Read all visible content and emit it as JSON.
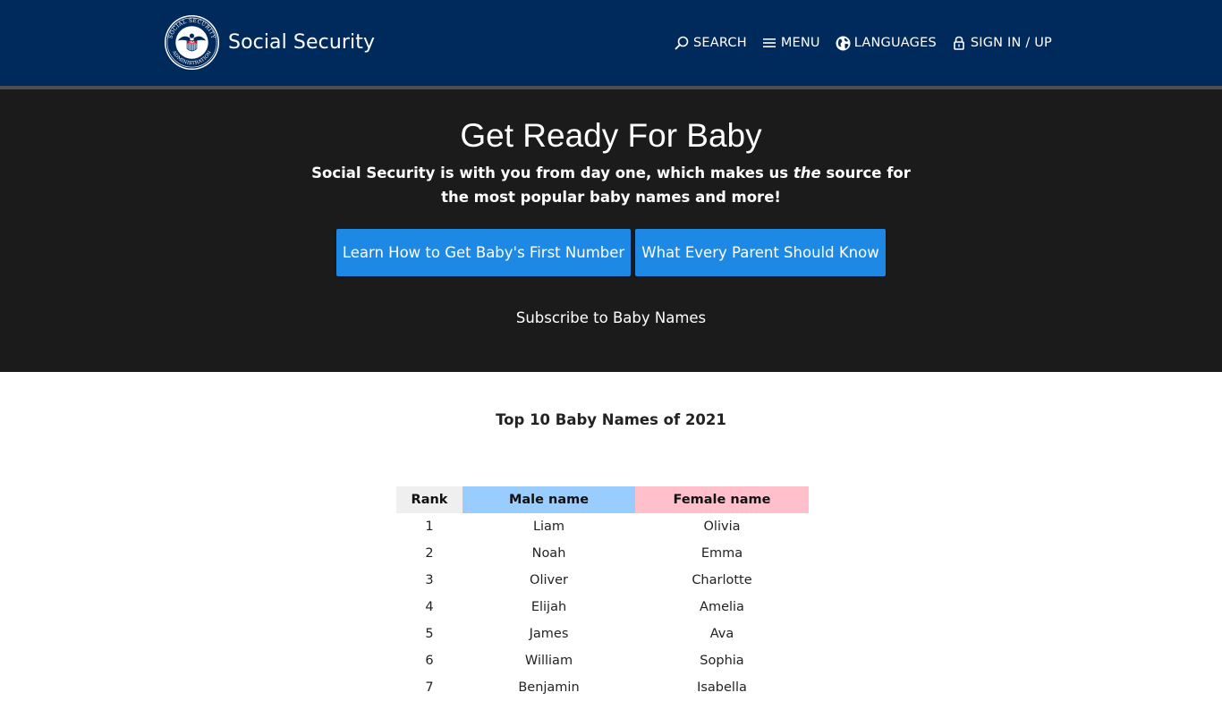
{
  "header": {
    "site_title": "Social Security",
    "seal": {
      "icon": "ssa-seal-icon",
      "top_text": "SOCIAL SECURITY",
      "bottom_text": "ADMINISTRATION",
      "center_text": "USA"
    },
    "nav": [
      {
        "label": "SEARCH",
        "icon": "search-icon"
      },
      {
        "label": "MENU",
        "icon": "menu-icon"
      },
      {
        "label": "LANGUAGES",
        "icon": "globe-icon"
      },
      {
        "label": "SIGN IN / UP",
        "icon": "lock-icon"
      }
    ],
    "colors": {
      "background": "#002a5c",
      "rule": "#4f4f4f"
    }
  },
  "hero": {
    "title": "Get Ready For Baby",
    "subtitle_before": "Social Security is with you from day one, which makes us ",
    "subtitle_em": "the",
    "subtitle_after": " source for the most popular baby names and more!",
    "buttons": [
      {
        "label": "Learn How to Get Baby's First Number"
      },
      {
        "label": "What Every Parent Should Know"
      }
    ],
    "subscribe_link": "Subscribe to Baby Names",
    "colors": {
      "background": "#1b1b1b",
      "button": "#1e88e5"
    }
  },
  "table": {
    "title": "Top 10 Baby Names of 2021",
    "headers": {
      "rank": "Rank",
      "male": "Male name",
      "female": "Female name"
    },
    "rows": [
      {
        "rank": "1",
        "male": "Liam",
        "female": "Olivia"
      },
      {
        "rank": "2",
        "male": "Noah",
        "female": "Emma"
      },
      {
        "rank": "3",
        "male": "Oliver",
        "female": "Charlotte"
      },
      {
        "rank": "4",
        "male": "Elijah",
        "female": "Amelia"
      },
      {
        "rank": "5",
        "male": "James",
        "female": "Ava"
      },
      {
        "rank": "6",
        "male": "William",
        "female": "Sophia"
      },
      {
        "rank": "7",
        "male": "Benjamin",
        "female": "Isabella"
      }
    ],
    "colors": {
      "rank_header": "#efefef",
      "male_header": "#99ccff",
      "female_header": "#ffc0cb"
    }
  }
}
